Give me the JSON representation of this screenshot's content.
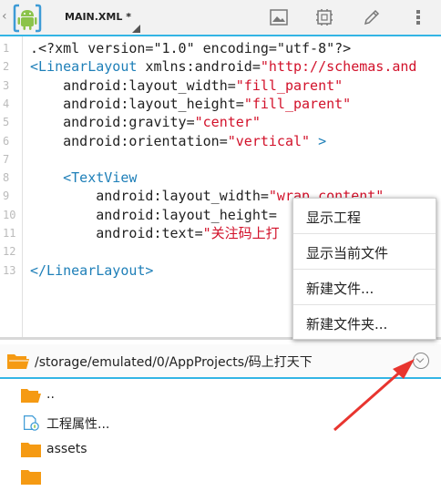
{
  "toolbar": {
    "file_tab": "MAIN.XML *"
  },
  "editor": {
    "lines": [
      {
        "n": "1",
        "parts": [
          {
            "t": ".<?xml version=\"1.0\" encoding=\"utf-8\"?>",
            "c": "attr"
          }
        ]
      },
      {
        "n": "2",
        "parts": [
          {
            "t": "<LinearLayout",
            "c": "tag"
          },
          {
            "t": " xmlns:android=",
            "c": "attr"
          },
          {
            "t": "\"http://schemas.and",
            "c": "str"
          }
        ]
      },
      {
        "n": "3",
        "parts": [
          {
            "t": "    android:layout_width=",
            "c": "attr"
          },
          {
            "t": "\"fill_parent\"",
            "c": "str"
          }
        ]
      },
      {
        "n": "4",
        "parts": [
          {
            "t": "    android:layout_height=",
            "c": "attr"
          },
          {
            "t": "\"fill_parent\"",
            "c": "str"
          }
        ]
      },
      {
        "n": "5",
        "parts": [
          {
            "t": "    android:gravity=",
            "c": "attr"
          },
          {
            "t": "\"center\"",
            "c": "str"
          }
        ]
      },
      {
        "n": "6",
        "parts": [
          {
            "t": "    android:orientation=",
            "c": "attr"
          },
          {
            "t": "\"vertical\"",
            "c": "str"
          },
          {
            "t": " >",
            "c": "tag"
          }
        ]
      },
      {
        "n": "7",
        "parts": []
      },
      {
        "n": "8",
        "parts": [
          {
            "t": "    <TextView",
            "c": "tag"
          }
        ]
      },
      {
        "n": "9",
        "parts": [
          {
            "t": "        android:layout_width=",
            "c": "attr"
          },
          {
            "t": "\"wrap_content\"",
            "c": "str"
          }
        ]
      },
      {
        "n": "10",
        "parts": [
          {
            "t": "        android:layout_height=",
            "c": "attr"
          }
        ]
      },
      {
        "n": "11",
        "parts": [
          {
            "t": "        android:text=",
            "c": "attr"
          },
          {
            "t": "\"关注码上打",
            "c": "str"
          }
        ]
      },
      {
        "n": "12",
        "parts": []
      },
      {
        "n": "13",
        "parts": [
          {
            "t": "</LinearLayout>",
            "c": "tag"
          }
        ]
      }
    ]
  },
  "context_menu": {
    "items": [
      "显示工程",
      "显示当前文件",
      "新建文件...",
      "新建文件夹..."
    ]
  },
  "path_bar": {
    "path": "/storage/emulated/0/AppProjects/码上打天下"
  },
  "file_list": {
    "items": [
      {
        "name": "..",
        "icon": "folder-open-icon"
      },
      {
        "name": "工程属性...",
        "icon": "project-properties-icon"
      },
      {
        "name": "assets",
        "icon": "folder-icon"
      },
      {
        "name": "",
        "icon": "folder-icon"
      }
    ]
  },
  "colors": {
    "accent": "#33b5e5",
    "tag": "#1e7fb8",
    "string": "#d2112a",
    "folder": "#f59a13",
    "arrow": "#e8352f"
  }
}
